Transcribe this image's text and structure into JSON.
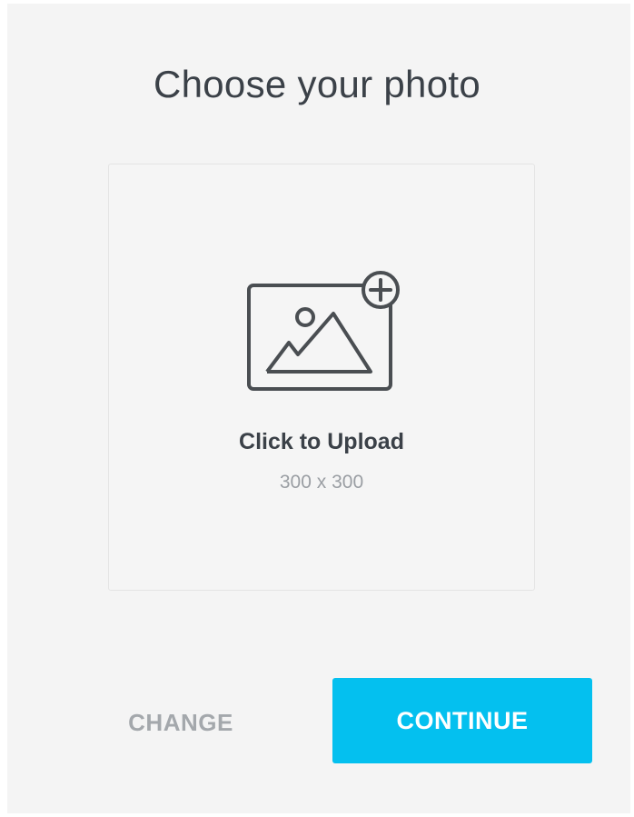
{
  "dialog": {
    "title": "Choose your photo"
  },
  "upload": {
    "label": "Click to Upload",
    "size_hint": "300 x 300",
    "icon": "image-add-icon"
  },
  "actions": {
    "change_label": "CHANGE",
    "continue_label": "CONTINUE"
  },
  "colors": {
    "accent": "#04c0ef",
    "text_primary": "#3b4148",
    "text_secondary": "#9a9ea3",
    "text_disabled": "#a4a8ac",
    "panel_background": "#f4f4f4",
    "icon_stroke": "#4a4e52"
  }
}
